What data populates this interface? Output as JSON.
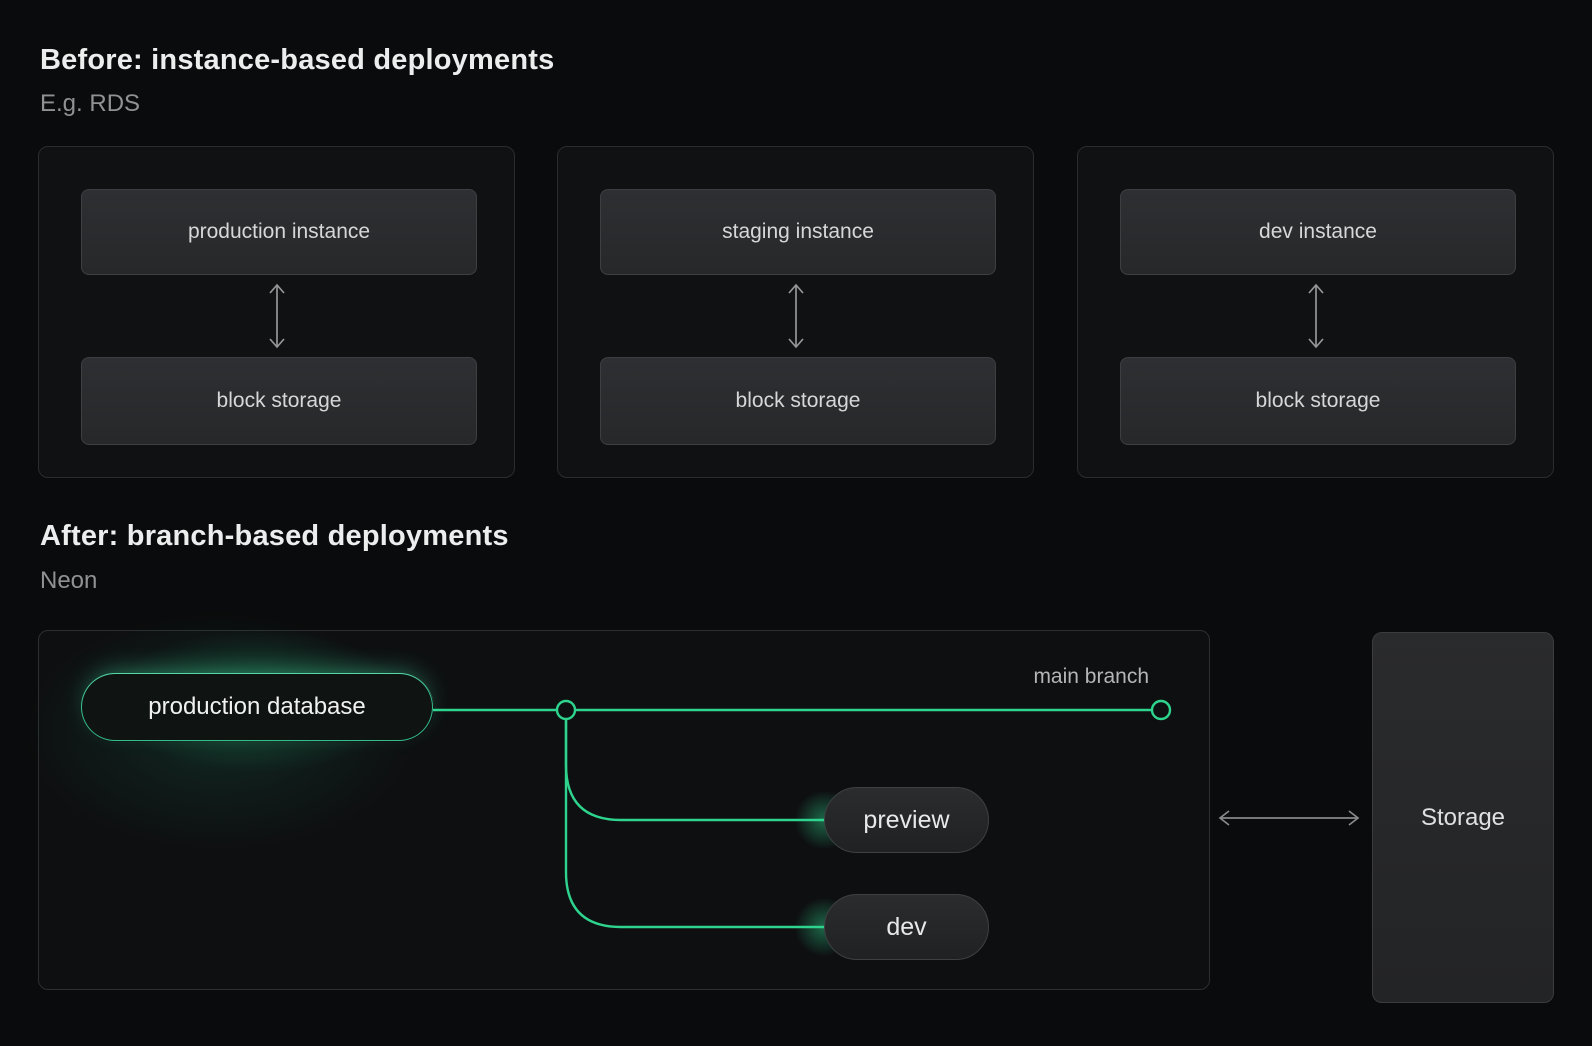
{
  "colors": {
    "accent_green": "#2ed48d",
    "arrow_gray": "#94969a",
    "page_background": "#0a0b0c"
  },
  "before": {
    "title": "Before: instance-based deployments",
    "subtitle": "E.g. RDS",
    "cards": [
      {
        "top": "production instance",
        "bottom": "block storage"
      },
      {
        "top": "staging instance",
        "bottom": "block storage"
      },
      {
        "top": "dev instance",
        "bottom": "block storage"
      }
    ]
  },
  "after": {
    "title": "After: branch-based deployments",
    "subtitle": "Neon",
    "database_label": "production database",
    "main_branch_label": "main branch",
    "branch_pills": [
      {
        "label": "preview"
      },
      {
        "label": "dev"
      }
    ],
    "storage_label": "Storage"
  }
}
